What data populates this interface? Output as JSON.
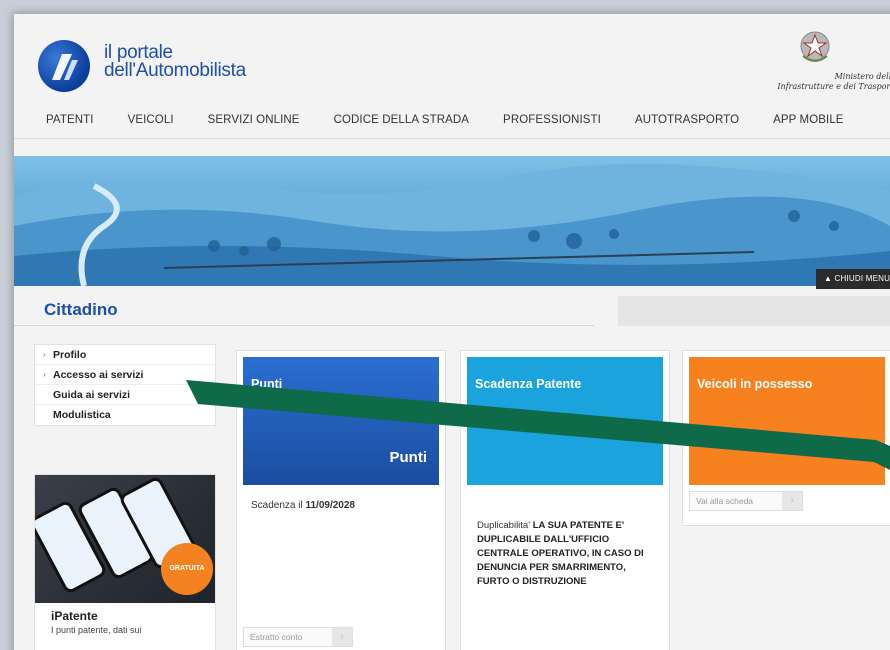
{
  "header": {
    "logo_line1": "il portale",
    "logo_line2": "dell'Automobilista",
    "ministry_line1": "Ministero delle",
    "ministry_line2": "Infrastrutture e dei Trasporti"
  },
  "nav": {
    "items": [
      "PATENTI",
      "VEICOLI",
      "SERVIZI ONLINE",
      "CODICE DELLA STRADA",
      "PROFESSIONISTI",
      "AUTOTRASPORTO",
      "APP MOBILE"
    ]
  },
  "banner": {
    "chiudi_label": "CHIUDI MENU"
  },
  "section": {
    "title": "Cittadino"
  },
  "sidebar": {
    "items": [
      {
        "label": "Profilo"
      },
      {
        "label": "Accesso ai servizi"
      },
      {
        "label": "Guida ai servizi"
      },
      {
        "label": "Modulistica"
      }
    ]
  },
  "promo": {
    "badge": "GRATUITA",
    "title": "iPatente",
    "desc": "I punti patente, dati sui"
  },
  "cards": {
    "punti": {
      "title": "Punti",
      "big": "Punti",
      "scadenza_prefix": "Scadenza il ",
      "scadenza_date": "11/09/2028",
      "button": "Estratto conto"
    },
    "scadenza": {
      "title": "Scadenza Patente",
      "dup_label": "Duplicabilita'",
      "dup_text": "LA SUA PATENTE E' DUPLICABILE DALL'UFFICIO CENTRALE OPERATIVO, IN CASO DI DENUNCIA PER SMARRIMENTO, FURTO O DISTRUZIONE"
    },
    "veicoli": {
      "title": "Veicoli in possesso",
      "button": "Vai alla scheda"
    }
  },
  "colors": {
    "brand_blue": "#1f4fa8",
    "card_blue": "#2a6fd1",
    "card_cyan": "#1aa3dd",
    "card_orange": "#f7811f",
    "overlay_arrow": "#0f6a4a"
  }
}
